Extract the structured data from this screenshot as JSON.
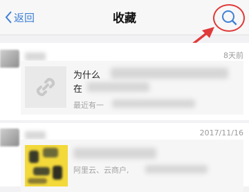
{
  "nav": {
    "back_label": "返回",
    "title": "收藏"
  },
  "items": [
    {
      "date": "8天前",
      "title_line1": "为什么",
      "title_line2": "在",
      "subtitle": "最近有一"
    },
    {
      "date": "2017/11/16",
      "subtitle": "阿里云、云商户,"
    }
  ],
  "colors": {
    "accent": "#3d7fd6",
    "annotation": "#e03a3a"
  }
}
